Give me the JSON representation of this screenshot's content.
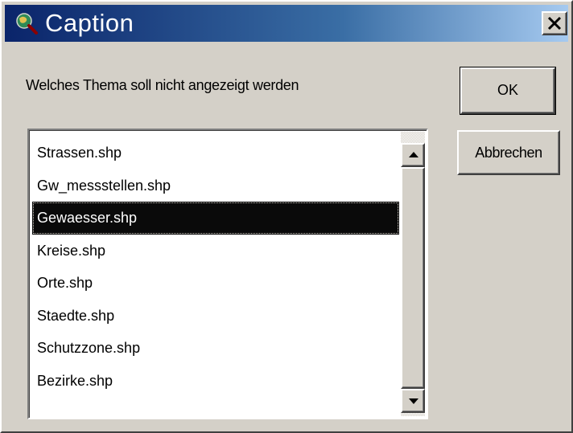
{
  "window": {
    "title": "Caption",
    "icon": "magnifier-globe-icon",
    "close_icon": "close-icon"
  },
  "dialog": {
    "prompt": "Welches Thema soll nicht angezeigt werden",
    "ok_label": "OK",
    "cancel_label": "Abbrechen"
  },
  "themes": {
    "items": [
      "Strassen.shp",
      "Gw_messstellen.shp",
      "Gewaesser.shp",
      "Kreise.shp",
      "Orte.shp",
      "Staedte.shp",
      "Schutzzone.shp",
      "Bezirke.shp"
    ],
    "selected": "Gewaesser.shp"
  },
  "colors": {
    "titlebar_start": "#0a246a",
    "titlebar_end": "#a6caf0",
    "dialog_face": "#d4d0c8",
    "selection": "#0a0a0a"
  }
}
